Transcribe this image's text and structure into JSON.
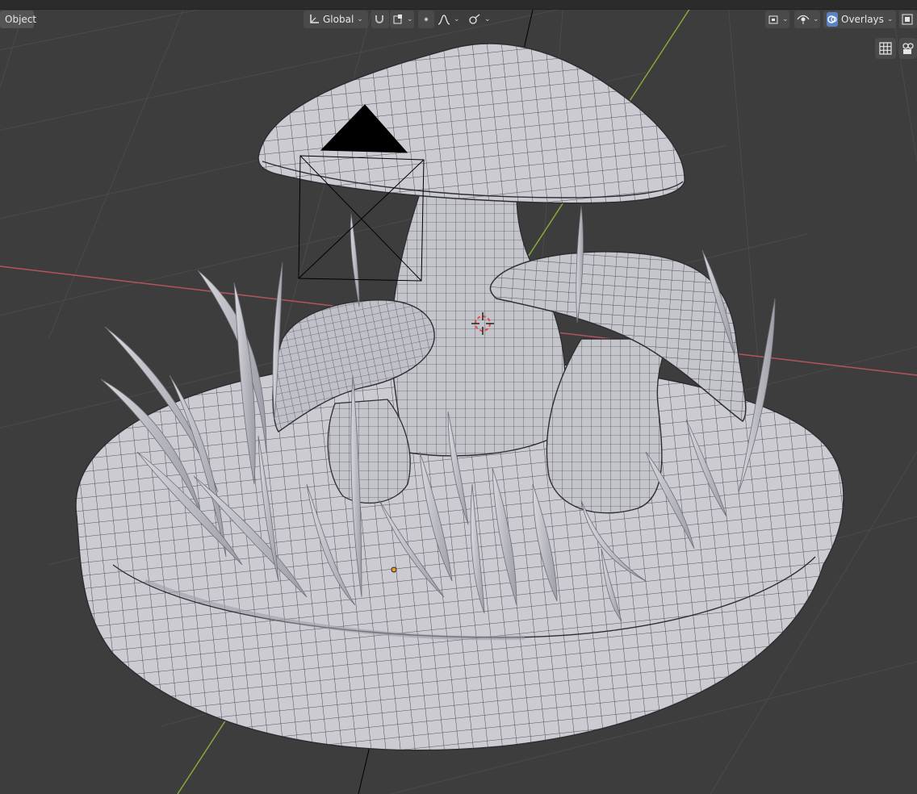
{
  "header": {
    "mode_label": "Object",
    "orientation_label": "Global",
    "overlays_label": "Overlays"
  },
  "icons": {
    "transform_orientation": "axes-icon",
    "pivot": "pivot-icon",
    "snap": "magnet-icon",
    "snap_target": "snap-target-icon",
    "proportional": "proportional-editing-icon",
    "falloff": "falloff-curve-icon",
    "visibility": "visibility-icon",
    "gizmo": "gizmo-eye-icon",
    "overlays": "overlays-icon",
    "perspective": "grid-icon",
    "camera": "camera-icon"
  },
  "colors": {
    "background": "#3d3d3d",
    "grid_line": "#4a4a4a",
    "x_axis": "#b3545c",
    "y_axis": "#86a93c",
    "mesh_fill": "#c9c9cf",
    "wire": "#2d2d33"
  }
}
